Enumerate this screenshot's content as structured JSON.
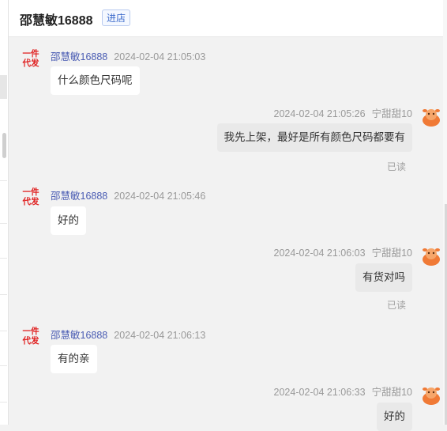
{
  "header": {
    "shop_name": "邵慧敏16888",
    "shop_button": "进店"
  },
  "badge": {
    "line1": "一件",
    "line2": "代发"
  },
  "messages": [
    {
      "direction": "in",
      "sender": "邵慧敏16888",
      "time": "2024-02-04 21:05:03",
      "text": "什么颜色尺码呢"
    },
    {
      "direction": "out",
      "sender": "宁甜甜10",
      "time": "2024-02-04 21:05:26",
      "text": "我先上架，最好是所有颜色尺码都要有",
      "status": "已读"
    },
    {
      "direction": "in",
      "sender": "邵慧敏16888",
      "time": "2024-02-04 21:05:46",
      "text": "好的"
    },
    {
      "direction": "out",
      "sender": "宁甜甜10",
      "time": "2024-02-04 21:06:03",
      "text": "有货对吗",
      "status": "已读"
    },
    {
      "direction": "in",
      "sender": "邵慧敏16888",
      "time": "2024-02-04 21:06:13",
      "text": "有的亲"
    },
    {
      "direction": "out",
      "sender": "宁甜甜10",
      "time": "2024-02-04 21:06:33",
      "text": "好的"
    }
  ],
  "colors": {
    "badge_red": "#e02222",
    "sender_link": "#4a5cb3",
    "avatar_orange": "#f07a36"
  }
}
